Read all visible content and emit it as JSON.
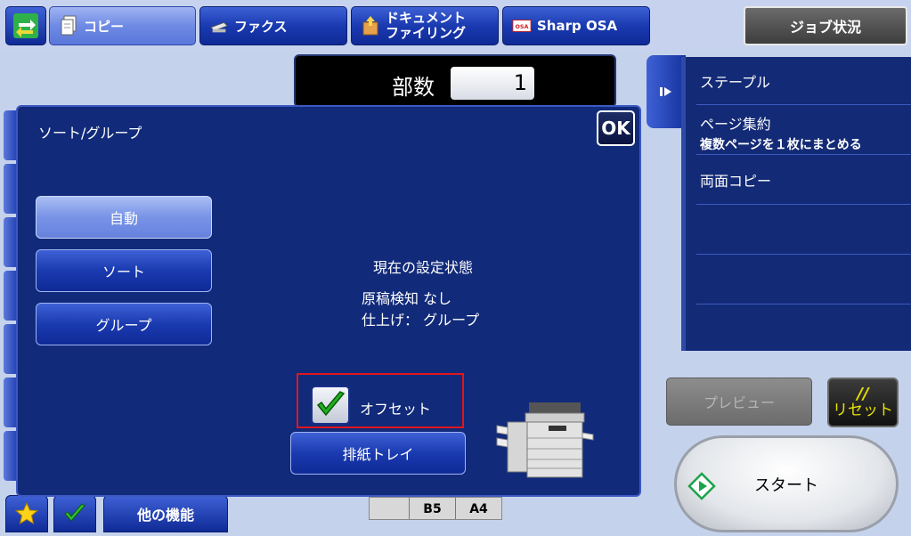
{
  "topbar": {
    "tabs": [
      {
        "label": "コピー",
        "icon": "copy-icon",
        "active": true
      },
      {
        "label": "ファクス",
        "icon": "fax-icon",
        "active": false
      },
      {
        "label_line1": "ドキュメント",
        "label_line2": "ファイリング",
        "icon": "document-filing-icon",
        "active": false
      },
      {
        "label": "Sharp OSA",
        "icon": "osa-icon",
        "active": false
      }
    ],
    "job_status_label": "ジョブ状況"
  },
  "copies": {
    "label": "部数",
    "value": "1"
  },
  "dialog": {
    "title": "ソート/グループ",
    "ok_label": "OK",
    "options": [
      {
        "label": "自動",
        "selected": true
      },
      {
        "label": "ソート",
        "selected": false
      },
      {
        "label": "グループ",
        "selected": false
      }
    ],
    "status_heading": "現在の設定状態",
    "status_line1": "原稿検知 なし",
    "status_line2": "仕上げ： グループ",
    "offset_label": "オフセット",
    "offset_checked": true,
    "tray_label": "排紙トレイ"
  },
  "right_panel": {
    "items": [
      {
        "label": "ステープル",
        "sub": ""
      },
      {
        "label": "ページ集約",
        "sub": "複数ページを１枚にまとめる"
      },
      {
        "label": "両面コピー",
        "sub": ""
      },
      {
        "label": "",
        "sub": ""
      },
      {
        "label": "",
        "sub": ""
      }
    ]
  },
  "preview_label": "プレビュー",
  "reset_symbol": "//",
  "reset_label": "リセット",
  "start_label": "スタート",
  "bottom": {
    "other_functions_label": "他の機能"
  },
  "paper_sizes": [
    "B5",
    "A4"
  ],
  "colors": {
    "accent": "#112a7a",
    "button": "#1a3ab0",
    "selected": "#7893e6",
    "highlight_border": "#e0161b",
    "reset_text": "#e8e000"
  }
}
